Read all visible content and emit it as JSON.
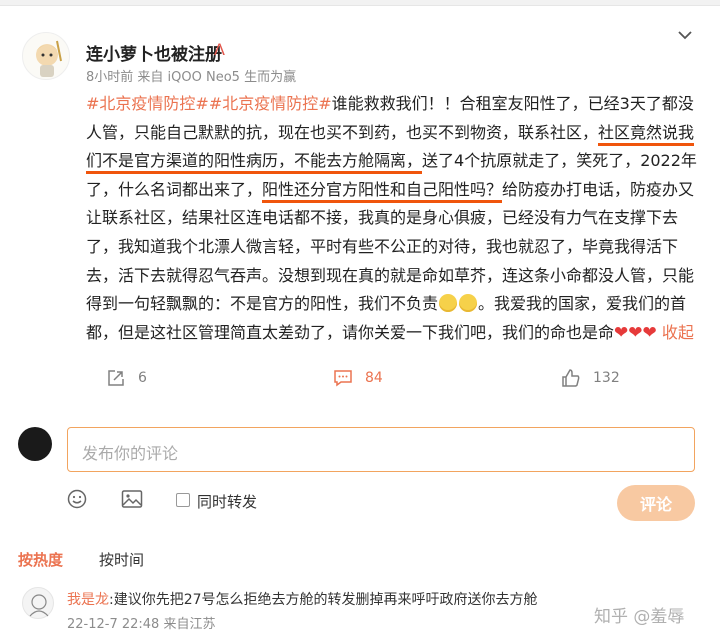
{
  "post": {
    "username": "连小萝卜也被注册",
    "vip_badge": "Λ",
    "time": "8小时前",
    "source": "来自 iQOO Neo5 生而为赢",
    "hashtag1": "#北京疫情防控#",
    "hashtag2": "#北京疫情防控#",
    "seg1": "谁能救救我们！！合租室友阳性了，已经3天了都没人管，只能自己默默的抗，现在也买不到药，也买不到物资，联系社区，",
    "hl1": "社区竟然说我们不是官方渠道的阳性病历，不能去方舱隔离，",
    "seg2": "送了4个抗原就走了，笑死了，2022年了，什么名词都出来了，",
    "hl2": "阳性还分官方阳性和自己阳性吗？",
    "seg3": "给防疫办打电话，防疫办又让联系社区，结果社区连电话都不接，我真的是身心俱疲，已经没有力气在支撑下去了，我知道我个北漂人微言轻，平时有些不公正的对待，我也就忍了，毕竟我得活下去，活下去就得忍气吞声。没想到现在真的就是命如草芥，连这条小命都没人管，只能得到一句轻飘飘的：不是官方的阳性，我们不负责",
    "seg4": "。我爱我的国家，爱我们的首都，但是这社区管理简直太差劲了，请你关爱一下我们吧，我们的命也是命",
    "hearts": "❤❤❤",
    "fold": "收起"
  },
  "actions": {
    "repost_count": "6",
    "comment_count": "84",
    "like_count": "132"
  },
  "composer": {
    "placeholder": "发布你的评论",
    "repost_label": "同时转发",
    "submit": "评论"
  },
  "sort": {
    "hot": "按热度",
    "time": "按时间"
  },
  "comment": {
    "user": "我是龙",
    "text": ":建议你先把27号怎么拒绝去方舱的转发删掉再来呼吁政府送你去方舱",
    "time": "22-12-7 22:48",
    "location": "来自江苏"
  },
  "watermark": "知乎 @羞辱",
  "colors": {
    "accent": "#eb7350",
    "highlight_underline": "#f0550c",
    "submit_bg": "#f8c9a2"
  }
}
